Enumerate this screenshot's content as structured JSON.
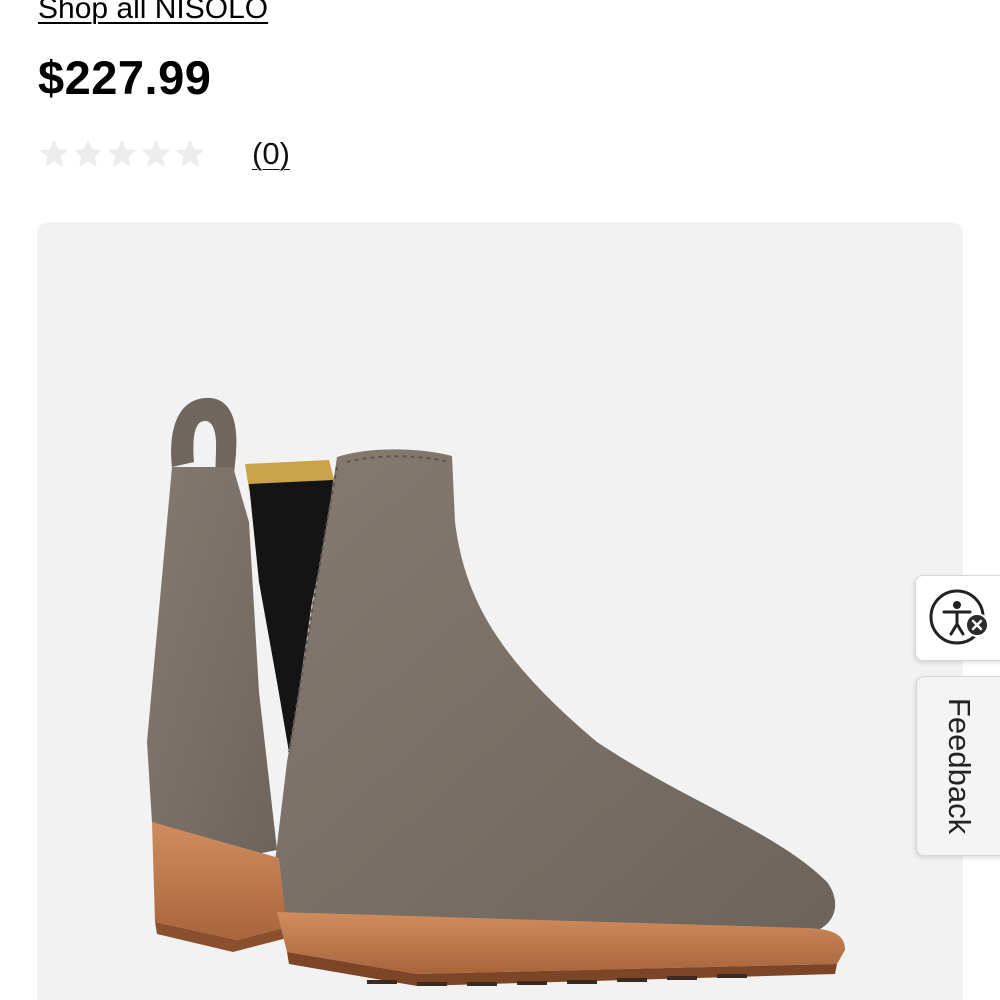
{
  "brand_link": {
    "label": "Shop all NISOLO"
  },
  "product": {
    "price": "$227.99",
    "rating_value": 0,
    "rating_max": 5,
    "review_count_label": "(0)",
    "image_icon": "chelsea-boot-photo"
  },
  "widgets": {
    "accessibility_icon": "accessibility-icon",
    "feedback_label": "Feedback"
  },
  "colors": {
    "text": "#000000",
    "star_empty": "#ececec",
    "image_bg": "#f2f2f2",
    "boot_suede": "#7d736a",
    "boot_elastic": "#141414",
    "boot_sole": "#c07a4e"
  }
}
